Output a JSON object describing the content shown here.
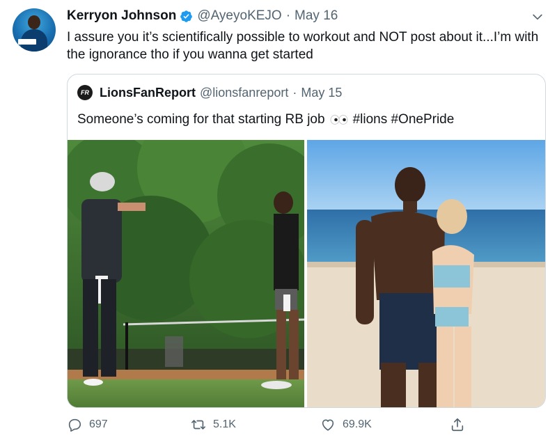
{
  "tweet": {
    "author": {
      "name": "Kerryon Johnson",
      "handle": "@AyeyoKEJO",
      "verified": true
    },
    "separator": "·",
    "date": "May 16",
    "text": "I assure you it’s scientifically possible to workout and NOT post about it...I’m with the ignorance tho if you wanna get started"
  },
  "quote": {
    "author": {
      "name": "LionsFanReport",
      "handle": "@lionsfanreport",
      "avatar_text": "FR"
    },
    "separator": "·",
    "date": "May 15",
    "text_before": "Someone’s coming for that starting RB job",
    "hashtags": "#lions #OnePride"
  },
  "actions": {
    "replies": "697",
    "retweets": "5.1K",
    "likes": "69.9K"
  },
  "colors": {
    "verified": "#1d9bf0",
    "secondary_text": "#536471",
    "border": "#cfd9de"
  },
  "icons": [
    "verified-badge-icon",
    "chevron-down-icon",
    "eyes-icon",
    "reply-icon",
    "retweet-icon",
    "like-icon",
    "share-icon"
  ]
}
